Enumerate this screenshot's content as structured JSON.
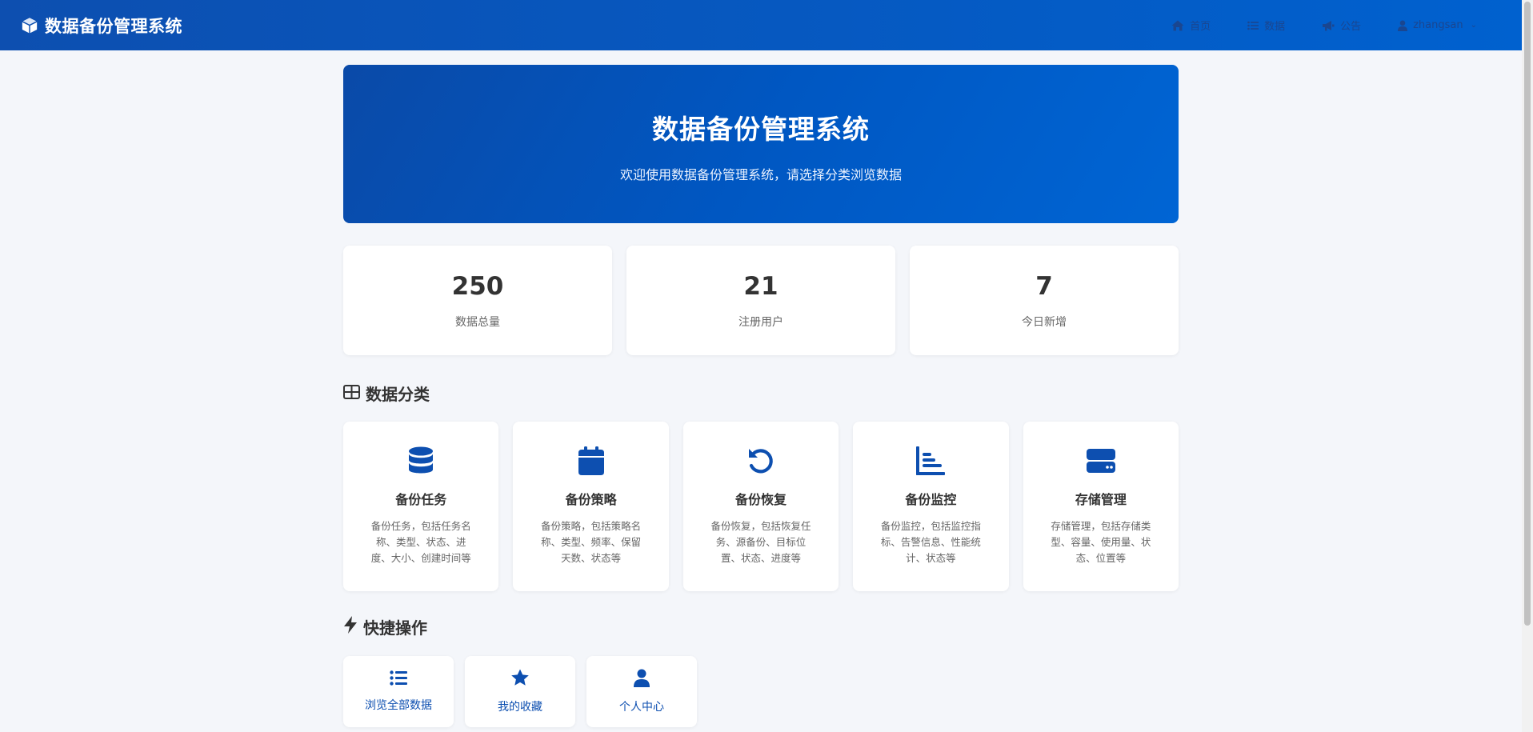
{
  "navbar": {
    "brand_icon": "cube-icon",
    "title": "数据备份管理系统",
    "items": [
      {
        "icon": "home-icon",
        "label": "首页"
      },
      {
        "icon": "list-icon",
        "label": "数据"
      },
      {
        "icon": "megaphone-icon",
        "label": "公告"
      }
    ],
    "user": {
      "icon": "user-icon",
      "label": "zhangsan",
      "chevron": "⌄"
    }
  },
  "hero": {
    "title": "数据备份管理系统",
    "subtitle": "欢迎使用数据备份管理系统，请选择分类浏览数据"
  },
  "stats": [
    {
      "value": "250",
      "label": "数据总量"
    },
    {
      "value": "21",
      "label": "注册用户"
    },
    {
      "value": "7",
      "label": "今日新增"
    }
  ],
  "categories_section": {
    "icon": "table-icon",
    "title": "数据分类"
  },
  "categories": [
    {
      "icon": "database-icon",
      "name": "备份任务",
      "desc": "备份任务，包括任务名称、类型、状态、进度、大小、创建时间等"
    },
    {
      "icon": "calendar-icon",
      "name": "备份策略",
      "desc": "备份策略，包括策略名称、类型、频率、保留天数、状态等"
    },
    {
      "icon": "undo-icon",
      "name": "备份恢复",
      "desc": "备份恢复，包括恢复任务、源备份、目标位置、状态、进度等"
    },
    {
      "icon": "chart-icon",
      "name": "备份监控",
      "desc": "备份监控，包括监控指标、告警信息、性能统计、状态等"
    },
    {
      "icon": "hard-drive-icon",
      "name": "存储管理",
      "desc": "存储管理，包括存储类型、容量、使用量、状态、位置等"
    }
  ],
  "quick_section": {
    "icon": "bolt-icon",
    "title": "快捷操作"
  },
  "quick_actions": [
    {
      "icon": "list-icon",
      "label": "浏览全部数据"
    },
    {
      "icon": "star-icon",
      "label": "我的收藏"
    },
    {
      "icon": "user-icon",
      "label": "个人中心"
    }
  ],
  "colors": {
    "primary": "#0d4fb0",
    "nav_text": "#1a4690",
    "background": "#f4f6fa"
  }
}
